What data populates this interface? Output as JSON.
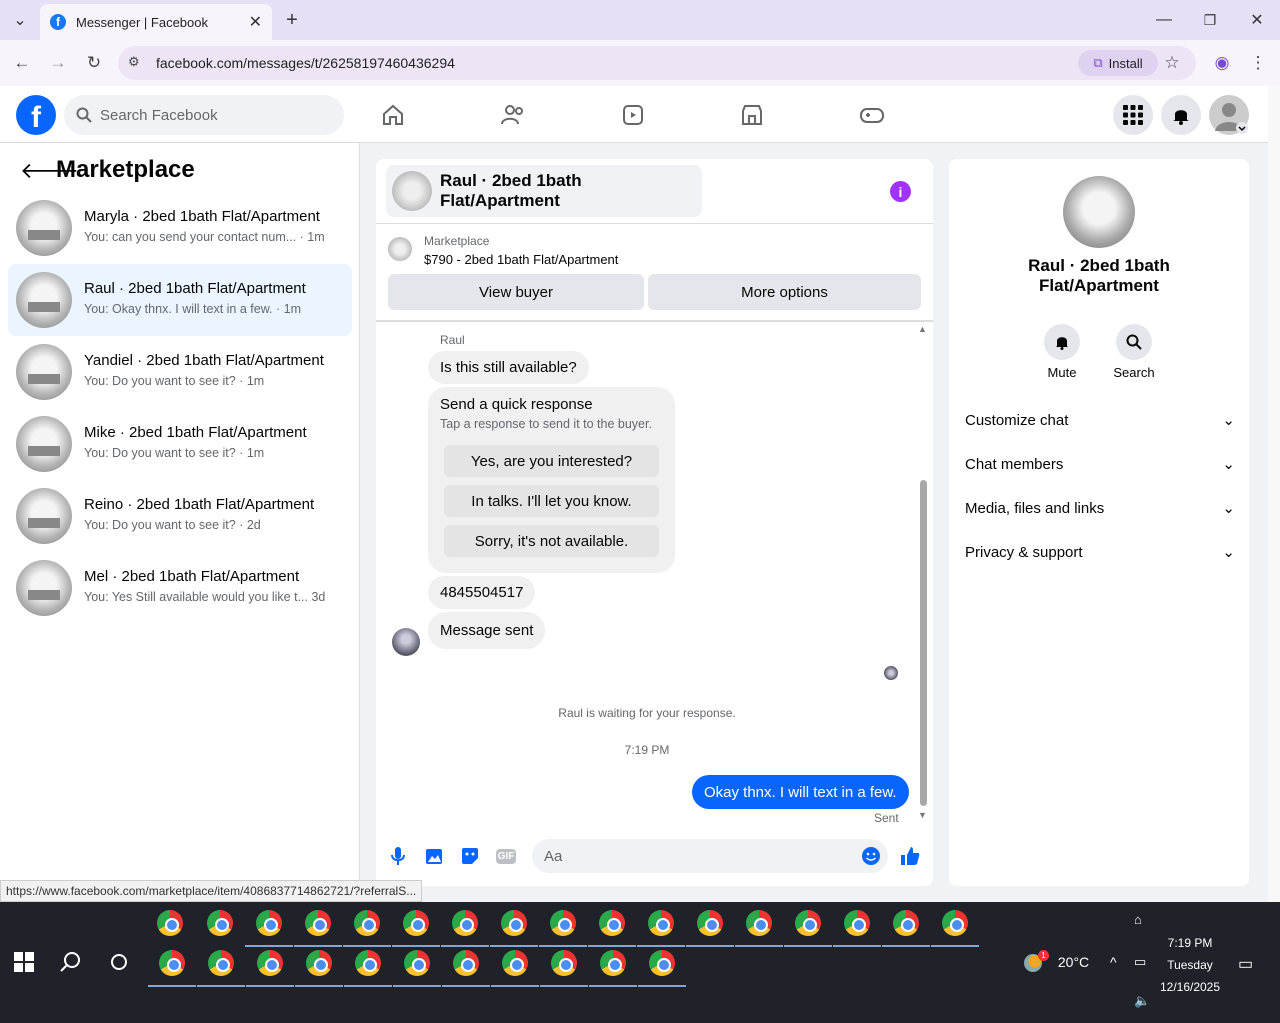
{
  "browser": {
    "tab_title": "Messenger | Facebook",
    "url": "facebook.com/messages/t/26258197460436294",
    "install_label": "Install",
    "status_url": "https://www.facebook.com/marketplace/item/4086837714862721/?referralS..."
  },
  "header": {
    "search_placeholder": "Search Facebook"
  },
  "sidebar": {
    "title": "Marketplace",
    "conversations": [
      {
        "name": "Maryla · 2bed 1bath Flat/Apartment",
        "preview": "You: can you send your contact num... · 1m"
      },
      {
        "name": "Raul · 2bed 1bath Flat/Apartment",
        "preview": "You: Okay thnx. I will text in a few. · 1m"
      },
      {
        "name": "Yandiel · 2bed 1bath Flat/Apartment",
        "preview": "You: Do you want to see it? · 1m"
      },
      {
        "name": "Mike · 2bed 1bath Flat/Apartment",
        "preview": "You: Do you want to see it? · 1m"
      },
      {
        "name": "Reino · 2bed 1bath Flat/Apartment",
        "preview": "You: Do you want to see it? · 2d"
      },
      {
        "name": "Mel · 2bed 1bath Flat/Apartment",
        "preview": "You: Yes Still available would you like t... 3d"
      }
    ]
  },
  "chat": {
    "title": "Raul · 2bed 1bath Flat/Apartment",
    "listing_source": "Marketplace",
    "listing_title": "$790 - 2bed 1bath Flat/Apartment",
    "view_buyer": "View buyer",
    "more_options": "More options",
    "sender_name": "Raul",
    "msg1": "Is this still available?",
    "quick_title": "Send a quick response",
    "quick_sub": "Tap a response to send it to the buyer.",
    "quick_options": [
      "Yes, are you interested?",
      "In talks. I'll let you know.",
      "Sorry, it's not available."
    ],
    "msg2": "4845504517",
    "msg3": "Message sent",
    "waiting": "Raul is waiting for your response.",
    "time": "7:19 PM",
    "my_msg": "Okay thnx. I will text in a few.",
    "sent": "Sent",
    "composer_placeholder": "Aa",
    "gif_label": "GIF"
  },
  "details": {
    "name": "Raul · 2bed 1bath Flat/Apartment",
    "mute": "Mute",
    "search": "Search",
    "sections": [
      "Customize chat",
      "Chat members",
      "Media, files and links",
      "Privacy & support"
    ]
  },
  "taskbar": {
    "temp": "20°C",
    "weather_badge": "1",
    "time": "7:19 PM",
    "day": "Tuesday",
    "date": "12/16/2025"
  },
  "colors": {
    "fb_blue": "#0866ff",
    "info_purple": "#a033ff",
    "active_row": "#ebf5ff"
  }
}
